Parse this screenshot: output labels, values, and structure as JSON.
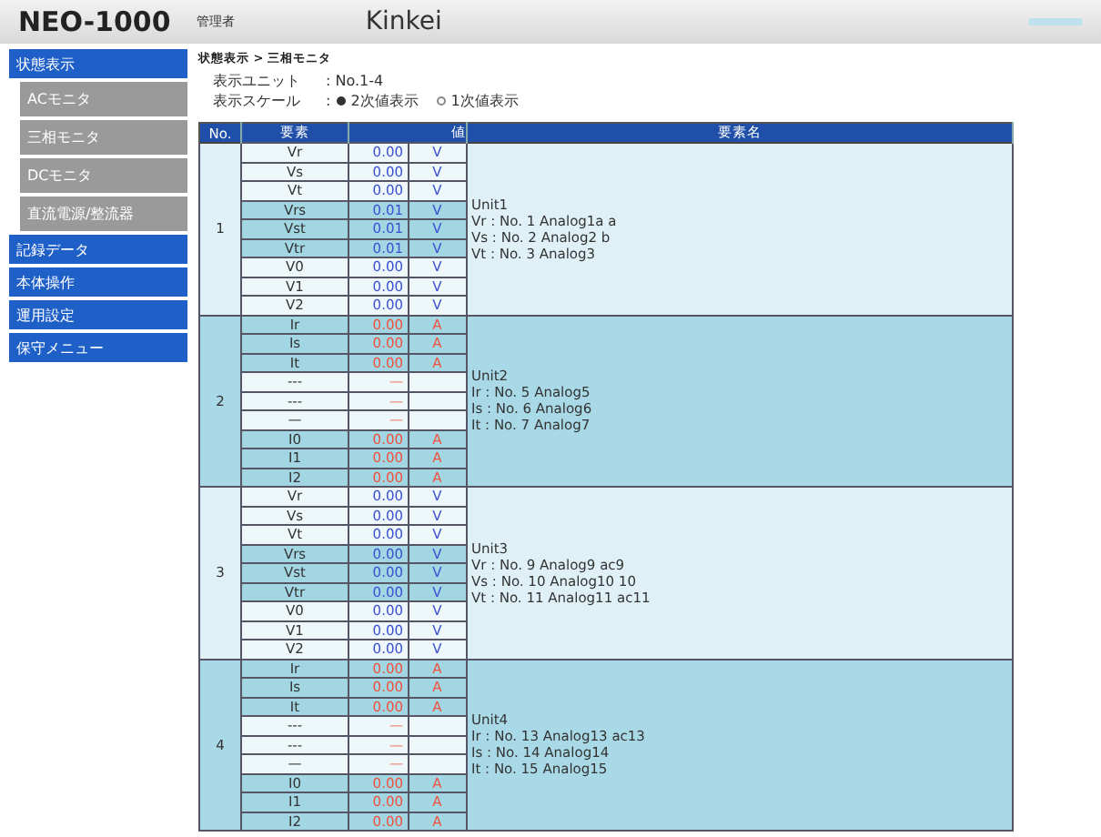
{
  "header": {
    "product": "NEO-1000",
    "user": "管理者",
    "company": "Kinkei"
  },
  "sidebar": {
    "items": [
      {
        "label": "状態表示",
        "kind": "category"
      },
      {
        "label": "ACモニタ",
        "kind": "sub"
      },
      {
        "label": "三相モニタ",
        "kind": "sub"
      },
      {
        "label": "DCモニタ",
        "kind": "sub"
      },
      {
        "label": "直流電源/整流器",
        "kind": "sub"
      },
      {
        "label": "記録データ",
        "kind": "category"
      },
      {
        "label": "本体操作",
        "kind": "category"
      },
      {
        "label": "運用設定",
        "kind": "category"
      },
      {
        "label": "保守メニュー",
        "kind": "category"
      }
    ]
  },
  "breadcrumb": "状態表示 > 三相モニタ",
  "settings": [
    {
      "label": "表示ユニット",
      "value": ": No.1-4"
    }
  ],
  "scale": {
    "label": "表示スケール",
    "separator": ":",
    "options": [
      {
        "label": "2次値表示",
        "selected": true
      },
      {
        "label": "1次値表示",
        "selected": false
      }
    ]
  },
  "table": {
    "columns": [
      "No.",
      "要素",
      "値",
      "要素名"
    ],
    "groups": [
      {
        "no": "1",
        "shaded": false,
        "name_lines": [
          "Unit1",
          "Vr : No. 1 Analog1a a",
          "Vs : No. 2 Analog2 b",
          "Vt : No. 3 Analog3"
        ],
        "rows": [
          {
            "element": "Vr",
            "value": "0.00",
            "unit": "V",
            "kind": "voltage",
            "highlight": false
          },
          {
            "element": "Vs",
            "value": "0.00",
            "unit": "V",
            "kind": "voltage",
            "highlight": false
          },
          {
            "element": "Vt",
            "value": "0.00",
            "unit": "V",
            "kind": "voltage",
            "highlight": false
          },
          {
            "element": "Vrs",
            "value": "0.01",
            "unit": "V",
            "kind": "voltage",
            "highlight": true
          },
          {
            "element": "Vst",
            "value": "0.01",
            "unit": "V",
            "kind": "voltage",
            "highlight": true
          },
          {
            "element": "Vtr",
            "value": "0.01",
            "unit": "V",
            "kind": "voltage",
            "highlight": true
          },
          {
            "element": "V0",
            "value": "0.00",
            "unit": "V",
            "kind": "voltage",
            "highlight": false
          },
          {
            "element": "V1",
            "value": "0.00",
            "unit": "V",
            "kind": "voltage",
            "highlight": false
          },
          {
            "element": "V2",
            "value": "0.00",
            "unit": "V",
            "kind": "voltage",
            "highlight": false
          }
        ]
      },
      {
        "no": "2",
        "shaded": true,
        "name_lines": [
          "Unit2",
          "Ir : No. 5 Analog5",
          "Is : No. 6 Analog6",
          "It : No. 7 Analog7"
        ],
        "rows": [
          {
            "element": "Ir",
            "value": "0.00",
            "unit": "A",
            "kind": "current",
            "highlight": true
          },
          {
            "element": "Is",
            "value": "0.00",
            "unit": "A",
            "kind": "current",
            "highlight": true
          },
          {
            "element": "It",
            "value": "0.00",
            "unit": "A",
            "kind": "current",
            "highlight": true
          },
          {
            "element": "---",
            "value": "—",
            "kind": "empty",
            "highlight": false
          },
          {
            "element": "---",
            "value": "—",
            "kind": "empty",
            "highlight": false
          },
          {
            "element": "—",
            "value": "—",
            "kind": "empty",
            "highlight": false
          },
          {
            "element": "I0",
            "value": "0.00",
            "unit": "A",
            "kind": "current",
            "highlight": true
          },
          {
            "element": "I1",
            "value": "0.00",
            "unit": "A",
            "kind": "current",
            "highlight": true
          },
          {
            "element": "I2",
            "value": "0.00",
            "unit": "A",
            "kind": "current",
            "highlight": true
          }
        ]
      },
      {
        "no": "3",
        "shaded": false,
        "name_lines": [
          "Unit3",
          "Vr : No. 9 Analog9 ac9",
          "Vs : No. 10 Analog10 10",
          "Vt : No. 11 Analog11 ac11"
        ],
        "rows": [
          {
            "element": "Vr",
            "value": "0.00",
            "unit": "V",
            "kind": "voltage",
            "highlight": false
          },
          {
            "element": "Vs",
            "value": "0.00",
            "unit": "V",
            "kind": "voltage",
            "highlight": false
          },
          {
            "element": "Vt",
            "value": "0.00",
            "unit": "V",
            "kind": "voltage",
            "highlight": false
          },
          {
            "element": "Vrs",
            "value": "0.00",
            "unit": "V",
            "kind": "voltage",
            "highlight": true
          },
          {
            "element": "Vst",
            "value": "0.00",
            "unit": "V",
            "kind": "voltage",
            "highlight": true
          },
          {
            "element": "Vtr",
            "value": "0.00",
            "unit": "V",
            "kind": "voltage",
            "highlight": true
          },
          {
            "element": "V0",
            "value": "0.00",
            "unit": "V",
            "kind": "voltage",
            "highlight": false
          },
          {
            "element": "V1",
            "value": "0.00",
            "unit": "V",
            "kind": "voltage",
            "highlight": false
          },
          {
            "element": "V2",
            "value": "0.00",
            "unit": "V",
            "kind": "voltage",
            "highlight": false
          }
        ]
      },
      {
        "no": "4",
        "shaded": true,
        "name_lines": [
          "Unit4",
          "Ir : No. 13 Analog13 ac13",
          "Is : No. 14 Analog14",
          "It : No. 15 Analog15"
        ],
        "rows": [
          {
            "element": "Ir",
            "value": "0.00",
            "unit": "A",
            "kind": "current",
            "highlight": true
          },
          {
            "element": "Is",
            "value": "0.00",
            "unit": "A",
            "kind": "current",
            "highlight": true
          },
          {
            "element": "It",
            "value": "0.00",
            "unit": "A",
            "kind": "current",
            "highlight": true
          },
          {
            "element": "---",
            "value": "—",
            "kind": "empty",
            "highlight": false
          },
          {
            "element": "---",
            "value": "—",
            "kind": "empty",
            "highlight": false
          },
          {
            "element": "—",
            "value": "—",
            "kind": "empty",
            "highlight": false
          },
          {
            "element": "I0",
            "value": "0.00",
            "unit": "A",
            "kind": "current",
            "highlight": true
          },
          {
            "element": "I1",
            "value": "0.00",
            "unit": "A",
            "kind": "current",
            "highlight": true
          },
          {
            "element": "I2",
            "value": "0.00",
            "unit": "A",
            "kind": "current",
            "highlight": true
          }
        ]
      }
    ]
  }
}
